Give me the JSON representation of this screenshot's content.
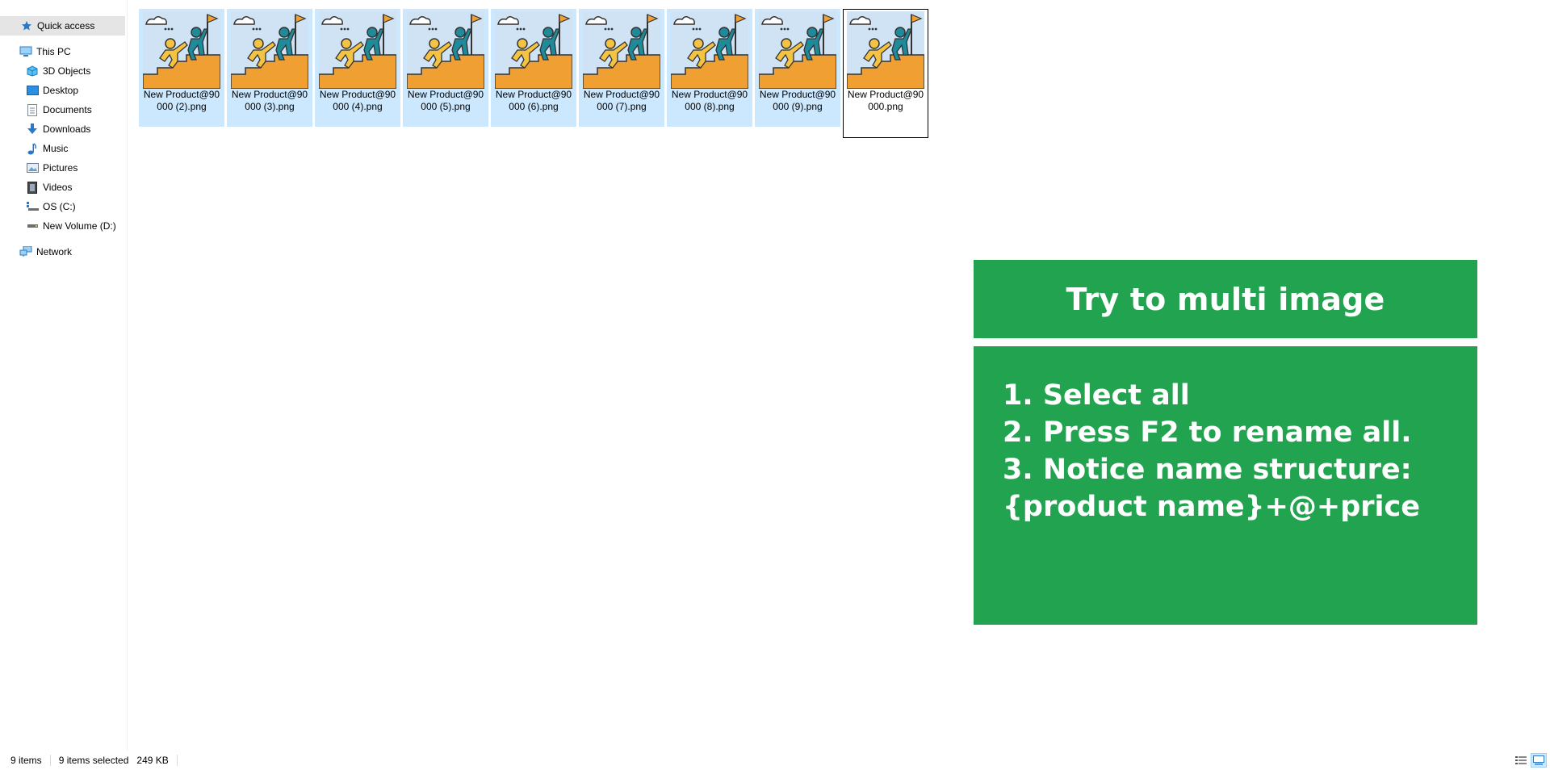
{
  "sidebar": {
    "quick_access": "Quick access",
    "this_pc": "This PC",
    "items": [
      {
        "label": "3D Objects",
        "icon": "3d-objects-icon"
      },
      {
        "label": "Desktop",
        "icon": "desktop-icon"
      },
      {
        "label": "Documents",
        "icon": "documents-icon"
      },
      {
        "label": "Downloads",
        "icon": "downloads-icon"
      },
      {
        "label": "Music",
        "icon": "music-icon"
      },
      {
        "label": "Pictures",
        "icon": "pictures-icon"
      },
      {
        "label": "Videos",
        "icon": "videos-icon"
      },
      {
        "label": "OS (C:)",
        "icon": "drive-c-icon"
      },
      {
        "label": "New Volume (D:)",
        "icon": "drive-d-icon"
      }
    ],
    "network": "Network"
  },
  "files": [
    {
      "name": "New Product@90000 (2).png"
    },
    {
      "name": "New Product@90000 (3).png"
    },
    {
      "name": "New Product@90000 (4).png"
    },
    {
      "name": "New Product@90000 (5).png"
    },
    {
      "name": "New Product@90000 (6).png"
    },
    {
      "name": "New Product@90000 (7).png"
    },
    {
      "name": "New Product@90000 (8).png"
    },
    {
      "name": "New Product@90000 (9).png"
    },
    {
      "name": "New Product@90000.png"
    }
  ],
  "overlay": {
    "title": "Try to multi image",
    "steps": [
      "1. Select all",
      "2. Press F2 to rename all.",
      "3. Notice name structure:",
      "{product name}+@+price"
    ]
  },
  "status": {
    "count": "9 items",
    "selected": "9 items selected",
    "size": "249 KB"
  },
  "colors": {
    "selection": "#cce8ff",
    "card": "#22a34f",
    "thumb_bg": "#cfe3f5",
    "thumb_ground": "#f0a032",
    "figure_yellow": "#f5c342",
    "figure_teal": "#1f8a9a"
  }
}
